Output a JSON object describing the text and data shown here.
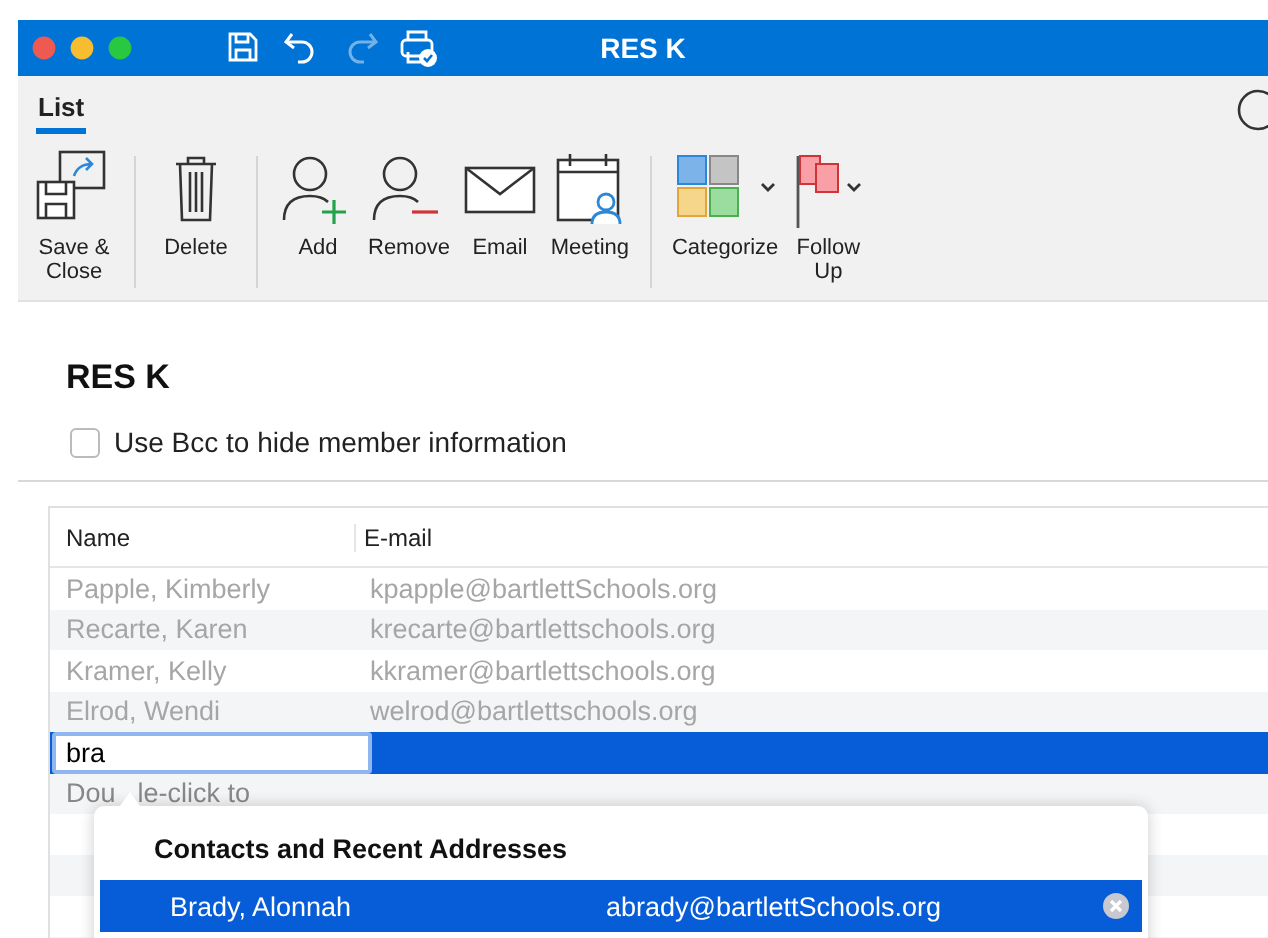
{
  "window": {
    "title": "RES K"
  },
  "quick_access": [
    {
      "kind": "save",
      "disabled": false
    },
    {
      "kind": "undo",
      "disabled": false
    },
    {
      "kind": "redo",
      "disabled": true
    },
    {
      "kind": "print",
      "disabled": false
    }
  ],
  "ribbon": {
    "tabs": [
      {
        "label": "List",
        "selected": true
      }
    ],
    "groups": [
      [
        {
          "kind": "save-close",
          "label": "Save & Close"
        }
      ],
      [
        {
          "kind": "delete",
          "label": "Delete"
        }
      ],
      [
        {
          "kind": "add",
          "label": "Add"
        },
        {
          "kind": "remove",
          "label": "Remove"
        },
        {
          "kind": "email",
          "label": "Email"
        },
        {
          "kind": "meeting",
          "label": "Meeting"
        }
      ],
      [
        {
          "kind": "categorize",
          "label": "Categorize",
          "dropdown": true
        },
        {
          "kind": "follow-up",
          "label": "Follow Up",
          "dropdown": true
        }
      ]
    ]
  },
  "list_name": "RES K",
  "bcc": {
    "label": "Use Bcc to hide member information",
    "checked": false
  },
  "table": {
    "columns": [
      "Name",
      "E-mail"
    ],
    "rows": [
      {
        "name": "Papple, Kimberly",
        "email": "kpapple@bartlettSchools.org"
      },
      {
        "name": "Recarte, Karen",
        "email": "krecarte@bartlettschools.org"
      },
      {
        "name": "Kramer, Kelly",
        "email": "kkramer@bartlettschools.org"
      },
      {
        "name": "Elrod, Wendi",
        "email": "welrod@bartlettschools.org"
      }
    ],
    "entry": {
      "value": "bra",
      "selected": true
    },
    "hint": [
      "Dou",
      "le-click to"
    ]
  },
  "autocomplete": {
    "title": "Contacts and Recent Addresses",
    "items": [
      {
        "name": "Brady, Alonnah",
        "email": "abrady@bartlettSchools.org",
        "selected": true
      }
    ]
  }
}
